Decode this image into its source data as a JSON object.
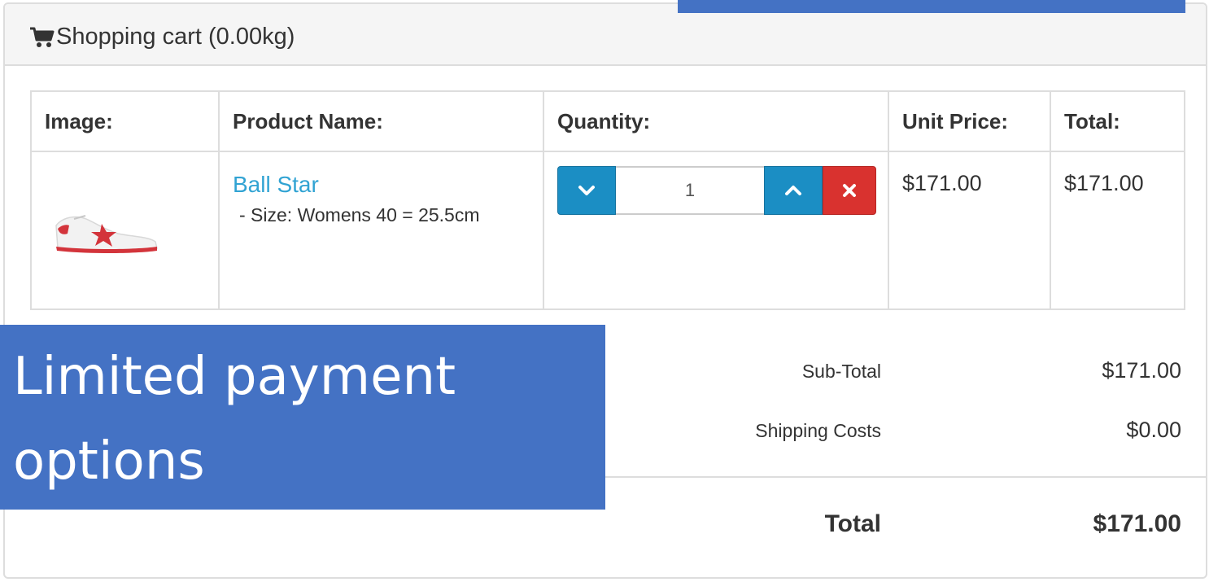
{
  "cart": {
    "title": "Shopping cart (0.00kg)",
    "icon": "shopping-cart-icon"
  },
  "table": {
    "headers": [
      "Image:",
      "Product Name:",
      "Quantity:",
      "Unit Price:",
      "Total:"
    ],
    "rows": [
      {
        "product_name": "Ball Star",
        "option": "- Size: Womens 40 = 25.5cm",
        "quantity": "1",
        "unit_price": "$171.00",
        "total": "$171.00"
      }
    ]
  },
  "totals": {
    "subtotal_label": "Sub-Total",
    "subtotal_value": "$171.00",
    "shipping_label": "Shipping Costs",
    "shipping_value": "$0.00",
    "total_label": "Total",
    "total_value": "$171.00"
  },
  "overlay": {
    "text": "Limited payment options"
  },
  "colors": {
    "link": "#31a3d3",
    "button_primary": "#1b8ec4",
    "button_danger": "#d9322f",
    "overlay": "#4472c4"
  }
}
